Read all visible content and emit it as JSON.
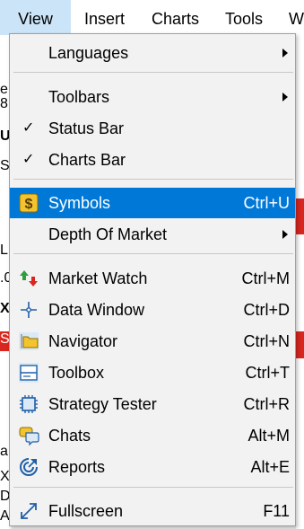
{
  "menubar": {
    "items": [
      {
        "label": "View"
      },
      {
        "label": "Insert"
      },
      {
        "label": "Charts"
      },
      {
        "label": "Tools"
      },
      {
        "label": "W"
      }
    ]
  },
  "background": {
    "left_fragments": [
      "e",
      "8",
      "U",
      "S",
      "L",
      ".0",
      "X",
      "S",
      "a",
      "X",
      "D",
      "A"
    ]
  },
  "menu": {
    "languages": {
      "label": "Languages"
    },
    "toolbars": {
      "label": "Toolbars"
    },
    "status_bar": {
      "label": "Status Bar",
      "checked": "✓"
    },
    "charts_bar": {
      "label": "Charts Bar",
      "checked": "✓"
    },
    "symbols": {
      "label": "Symbols",
      "shortcut": "Ctrl+U"
    },
    "depth_of_market": {
      "label": "Depth Of Market"
    },
    "market_watch": {
      "label": "Market Watch",
      "shortcut": "Ctrl+M"
    },
    "data_window": {
      "label": "Data Window",
      "shortcut": "Ctrl+D"
    },
    "navigator": {
      "label": "Navigator",
      "shortcut": "Ctrl+N"
    },
    "toolbox": {
      "label": "Toolbox",
      "shortcut": "Ctrl+T"
    },
    "strategy_tester": {
      "label": "Strategy Tester",
      "shortcut": "Ctrl+R"
    },
    "chats": {
      "label": "Chats",
      "shortcut": "Alt+M"
    },
    "reports": {
      "label": "Reports",
      "shortcut": "Alt+E"
    },
    "fullscreen": {
      "label": "Fullscreen",
      "shortcut": "F11"
    }
  },
  "colors": {
    "highlight": "#0078d7",
    "menubar_active": "#cce4f7",
    "accent_red": "#d9261f"
  }
}
